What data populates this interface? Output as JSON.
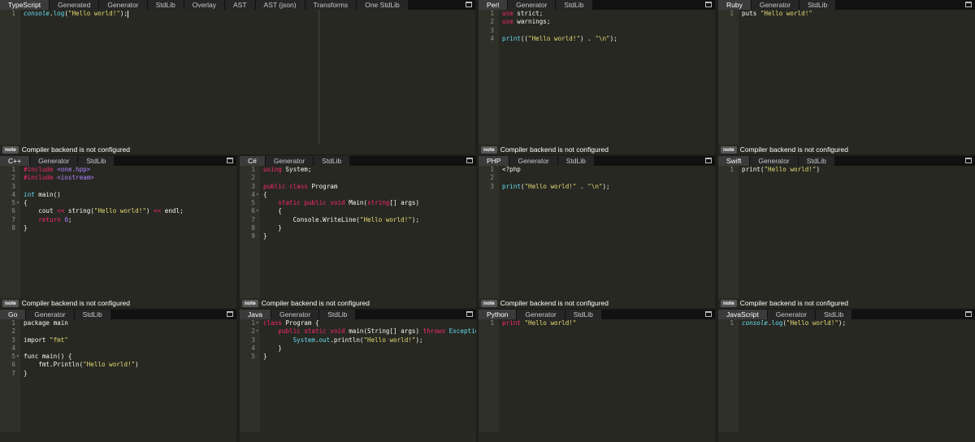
{
  "status_note": "note",
  "status_message": "Compiler backend is not configured",
  "panes": [
    {
      "id": "typescript",
      "tabs": [
        "TypeScript",
        "Generated",
        "Generator",
        "StdLib",
        "Overlay",
        "AST",
        "AST (json)",
        "Transforms",
        "One StdLib"
      ],
      "lines": [
        [
          [
            "it",
            "console"
          ],
          [
            "",
            "."
          ],
          [
            "fn",
            "log"
          ],
          [
            "",
            "("
          ],
          [
            "str",
            "\"Hello world!\""
          ],
          [
            "",
            ");"
          ]
        ]
      ],
      "cursor_line": 1
    },
    {
      "id": "perl",
      "tabs": [
        "Perl",
        "Generator",
        "StdLib"
      ],
      "lines": [
        [
          [
            "kw",
            "use"
          ],
          [
            "",
            " strict;"
          ]
        ],
        [
          [
            "kw",
            "use"
          ],
          [
            "",
            " warnings;"
          ]
        ],
        [],
        [
          [
            "fn",
            "print"
          ],
          [
            "",
            "(("
          ],
          [
            "str",
            "\"Hello world!\""
          ],
          [
            "",
            ") . "
          ],
          [
            "str",
            "\"\\n\""
          ],
          [
            "",
            ");"
          ]
        ]
      ]
    },
    {
      "id": "ruby",
      "tabs": [
        "Ruby",
        "Generator",
        "StdLib"
      ],
      "lines": [
        [
          [
            "",
            "puts "
          ],
          [
            "str",
            "\"Hello world!\""
          ]
        ]
      ]
    },
    {
      "id": "cpp",
      "tabs": [
        "C++",
        "Generator",
        "StdLib"
      ],
      "lines": [
        [
          [
            "kw",
            "#include"
          ],
          [
            "",
            " "
          ],
          [
            "num",
            "<one.hpp>"
          ]
        ],
        [
          [
            "kw",
            "#include"
          ],
          [
            "",
            " "
          ],
          [
            "num",
            "<iostream>"
          ]
        ],
        [],
        [
          [
            "it",
            "int"
          ],
          [
            "",
            " main()"
          ]
        ],
        [
          [
            "",
            "{"
          ]
        ],
        [
          [
            "",
            "    cout "
          ],
          [
            "kw",
            "<<"
          ],
          [
            "",
            " string("
          ],
          [
            "str",
            "\"Hello world!\""
          ],
          [
            "",
            ") "
          ],
          [
            "kw",
            "<<"
          ],
          [
            "",
            " endl;"
          ]
        ],
        [
          [
            "",
            "    "
          ],
          [
            "kw",
            "return"
          ],
          [
            "",
            " "
          ],
          [
            "num",
            "0"
          ],
          [
            "",
            ";"
          ]
        ],
        [
          [
            "",
            "}"
          ]
        ]
      ],
      "folds": [
        5
      ]
    },
    {
      "id": "csharp",
      "tabs": [
        "C#",
        "Generator",
        "StdLib"
      ],
      "lines": [
        [
          [
            "kw",
            "using"
          ],
          [
            "",
            " System;"
          ]
        ],
        [],
        [
          [
            "kw",
            "public"
          ],
          [
            "",
            " "
          ],
          [
            "kw",
            "class"
          ],
          [
            "",
            " Program"
          ]
        ],
        [
          [
            "",
            "{"
          ]
        ],
        [
          [
            "",
            "    "
          ],
          [
            "kw",
            "static"
          ],
          [
            "",
            " "
          ],
          [
            "kw",
            "public"
          ],
          [
            "",
            " "
          ],
          [
            "kw",
            "void"
          ],
          [
            "",
            " Main("
          ],
          [
            "kw",
            "string"
          ],
          [
            "",
            "[] args)"
          ]
        ],
        [
          [
            "",
            "    {"
          ]
        ],
        [
          [
            "",
            "        Console.WriteLine("
          ],
          [
            "str",
            "\"Hello world!\""
          ],
          [
            "",
            ");"
          ]
        ],
        [
          [
            "",
            "    }"
          ]
        ],
        [
          [
            "",
            "}"
          ]
        ]
      ],
      "folds": [
        4,
        6
      ]
    },
    {
      "id": "php",
      "tabs": [
        "PHP",
        "Generator",
        "StdLib"
      ],
      "lines": [
        [
          [
            "",
            "<?php"
          ]
        ],
        [],
        [
          [
            "fn",
            "print"
          ],
          [
            "",
            "("
          ],
          [
            "str",
            "\"Hello world!\""
          ],
          [
            "",
            " . "
          ],
          [
            "str",
            "\"\\n\""
          ],
          [
            "",
            ");"
          ]
        ]
      ]
    },
    {
      "id": "swift",
      "tabs": [
        "Swift",
        "Generator",
        "StdLib"
      ],
      "lines": [
        [
          [
            "",
            "print("
          ],
          [
            "str",
            "\"Hello world!\""
          ],
          [
            "",
            ")"
          ]
        ]
      ]
    },
    {
      "id": "go",
      "tabs": [
        "Go",
        "Generator",
        "StdLib"
      ],
      "lines": [
        [
          [
            "",
            "package main"
          ]
        ],
        [],
        [
          [
            "",
            "import "
          ],
          [
            "str",
            "\"fmt\""
          ]
        ],
        [],
        [
          [
            "",
            "func main() {"
          ]
        ],
        [
          [
            "",
            "    fmt.Println("
          ],
          [
            "str",
            "\"Hello world!\""
          ],
          [
            "",
            ")"
          ]
        ],
        [
          [
            "",
            "}"
          ]
        ]
      ],
      "folds": [
        5
      ]
    },
    {
      "id": "java",
      "tabs": [
        "Java",
        "Generator",
        "StdLib"
      ],
      "lines": [
        [
          [
            "kw",
            "class"
          ],
          [
            "",
            " Program {"
          ]
        ],
        [
          [
            "",
            "    "
          ],
          [
            "kw",
            "public"
          ],
          [
            "",
            " "
          ],
          [
            "kw",
            "static"
          ],
          [
            "",
            " "
          ],
          [
            "kw",
            "void"
          ],
          [
            "",
            " main(String[] args) "
          ],
          [
            "kw",
            "throws"
          ],
          [
            "",
            " "
          ],
          [
            "fn",
            "Exception"
          ],
          [
            "",
            " {"
          ]
        ],
        [
          [
            "",
            "        "
          ],
          [
            "fn",
            "System"
          ],
          [
            "",
            "."
          ],
          [
            "fn",
            "out"
          ],
          [
            "",
            ".println("
          ],
          [
            "str",
            "\"Hello world!\""
          ],
          [
            "",
            ");"
          ]
        ],
        [
          [
            "",
            "    }"
          ]
        ],
        [
          [
            "",
            "}"
          ]
        ]
      ],
      "folds": [
        1,
        2
      ]
    },
    {
      "id": "python",
      "tabs": [
        "Python",
        "Generator",
        "StdLib"
      ],
      "lines": [
        [
          [
            "kw",
            "print"
          ],
          [
            "",
            " "
          ],
          [
            "str",
            "\"Hello world!\""
          ]
        ]
      ]
    },
    {
      "id": "javascript",
      "tabs": [
        "JavaScript",
        "Generator",
        "StdLib"
      ],
      "lines": [
        [
          [
            "it",
            "console"
          ],
          [
            "",
            "."
          ],
          [
            "fn",
            "log"
          ],
          [
            "",
            "("
          ],
          [
            "str",
            "\"Hello world!\""
          ],
          [
            "",
            ");"
          ]
        ]
      ]
    }
  ]
}
